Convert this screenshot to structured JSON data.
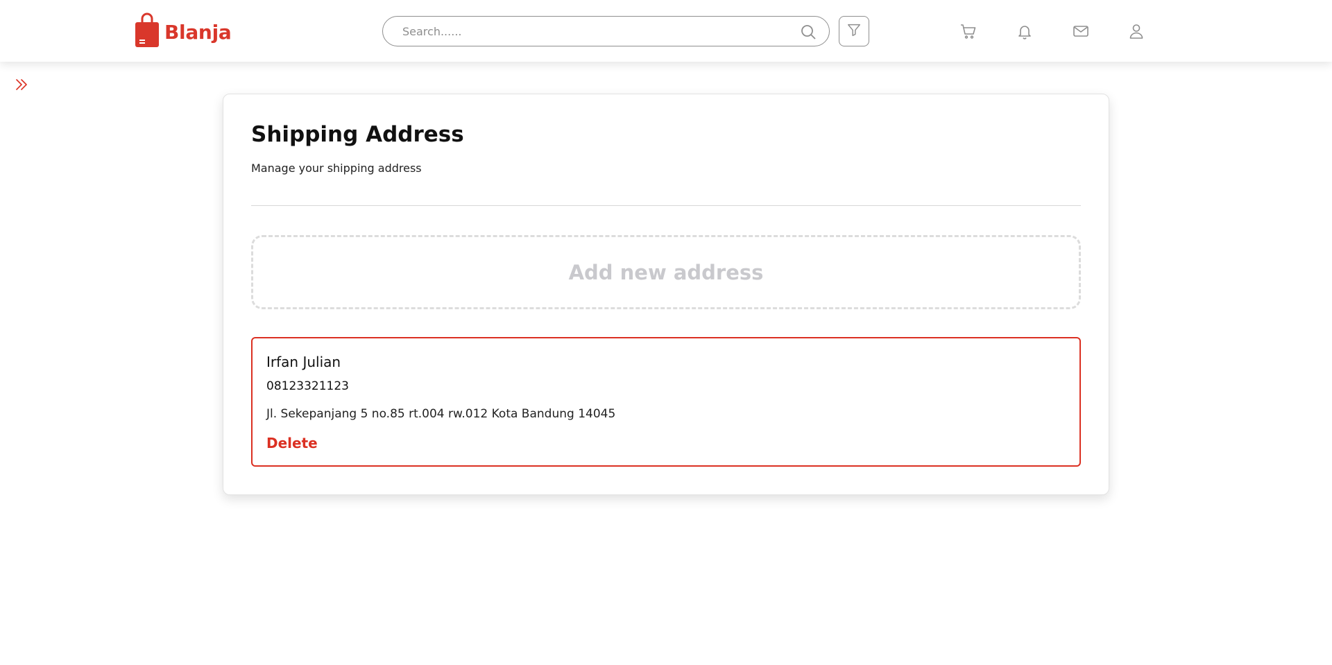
{
  "brand": {
    "name": "Blanja",
    "accent_color": "#DB3022",
    "logo_icon": "shopping-bag-icon"
  },
  "header": {
    "search": {
      "placeholder": "Search......",
      "icon": "search-icon"
    },
    "filter_icon": "filter-icon",
    "icons": [
      "cart-icon",
      "bell-icon",
      "mail-icon",
      "user-icon"
    ]
  },
  "sidebar_toggle_icon": "chevrons-right-icon",
  "shipping": {
    "title": "Shipping Address",
    "subtitle": "Manage your shipping address",
    "add_label": "Add new address",
    "addresses": [
      {
        "name": "Irfan Julian",
        "phone": "08123321123",
        "address": "Jl. Sekepanjang 5 no.85 rt.004 rw.012 Kota Bandung 14045",
        "delete_label": "Delete"
      }
    ]
  }
}
